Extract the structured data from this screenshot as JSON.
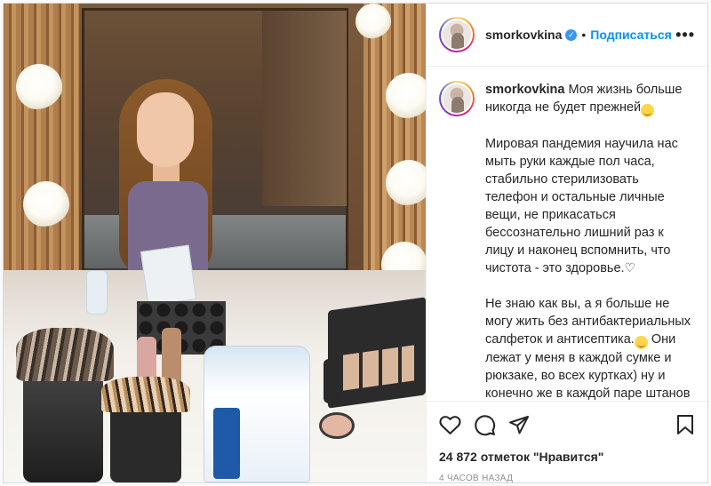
{
  "header": {
    "username": "smorkovkina",
    "separator": "•",
    "follow_label": "Подписаться",
    "more_label": "•••"
  },
  "caption": {
    "username": "smorkovkina",
    "line1": "Моя жизнь больше никогда не будет прежней",
    "para2": "Мировая пандемия научила нас мыть руки каждые пол часа, стабильно стерилизовать телефон и остальные личные вещи, не прикасаться бессознательно лишний раз к лицу и наконец вспомнить, что чистота - это здоровье.",
    "heart": "♡",
    "para3a": "Не знаю как вы, а я больше не могу жить без антибактериальных салфеток и антисептика.",
    "para3b": " Они лежат у меня в каждой сумке и рюкзаке, во всех куртках) ну и конечно же в каждой паре штанов всегда спрятана минимум одна маска, уверена вам это знакомо"
  },
  "stats": {
    "likes": "24 872 отметок \"Нравится\"",
    "time": "4 ЧАСОВ НАЗАД"
  },
  "icons": {
    "like": "heart-icon",
    "comment": "comment-icon",
    "share": "share-icon",
    "save": "bookmark-icon",
    "verified": "verified-badge-icon"
  },
  "colors": {
    "accent": "#0095f6",
    "text": "#262626",
    "muted": "#8e8e8e",
    "verified": "#3897f0"
  }
}
